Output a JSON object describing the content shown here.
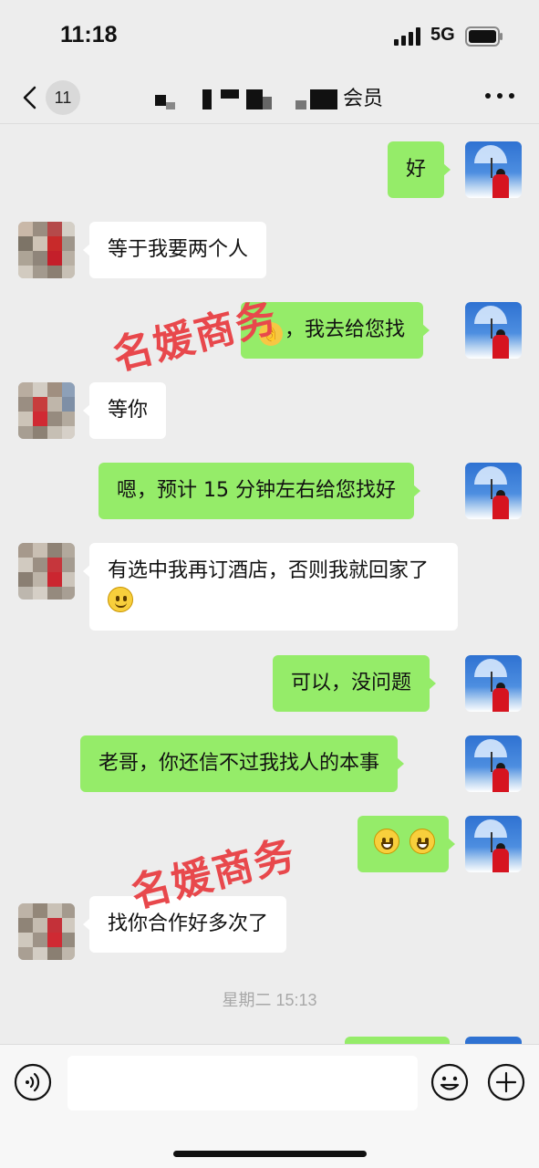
{
  "status_bar": {
    "time": "11:18",
    "network": "5G"
  },
  "header": {
    "unread_count": "11",
    "title": "会员"
  },
  "messages": [
    {
      "from": "me",
      "text": "好"
    },
    {
      "from": "friend",
      "text": "等于我要两个人"
    },
    {
      "from": "me",
      "emoji": "👌",
      "text": "，我去给您找"
    },
    {
      "from": "friend",
      "text": "等你"
    },
    {
      "from": "me",
      "text": "嗯，预计 15 分钟左右给您找好"
    },
    {
      "from": "friend",
      "text": "有选中我再订酒店，否则我就回家了"
    },
    {
      "from": "me",
      "text": "可以，没问题"
    },
    {
      "from": "me",
      "text": "老哥，你还信不过我找人的本事"
    },
    {
      "from": "me",
      "emoji": "grinning-faces"
    },
    {
      "from": "friend",
      "text": "找你合作好多次了"
    }
  ],
  "timestamp": "星期二 15:13",
  "watermark": "名媛商务",
  "input": {
    "value": ""
  },
  "colors": {
    "outgoing_bubble": "#95ec69",
    "incoming_bubble": "#ffffff",
    "background": "#ededed",
    "watermark": "#e8484c"
  }
}
